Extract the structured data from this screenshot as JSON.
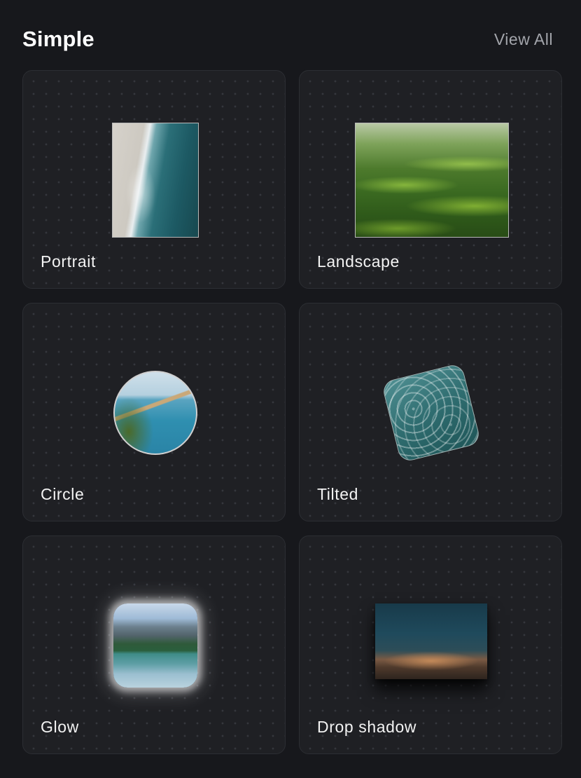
{
  "header": {
    "title": "Simple",
    "view_all_label": "View All"
  },
  "cards": [
    {
      "label": "Portrait",
      "image": "coastline-photo"
    },
    {
      "label": "Landscape",
      "image": "green-hills-photo"
    },
    {
      "label": "Circle",
      "image": "coast-sea-photo"
    },
    {
      "label": "Tilted",
      "image": "pool-water-photo"
    },
    {
      "label": "Glow",
      "image": "mountain-lake-photo"
    },
    {
      "label": "Drop shadow",
      "image": "night-desert-photo"
    }
  ],
  "colors": {
    "background": "#17181c",
    "card_background": "#1f2024",
    "card_border": "#2c2e33",
    "muted_text": "#a3a5ab"
  }
}
